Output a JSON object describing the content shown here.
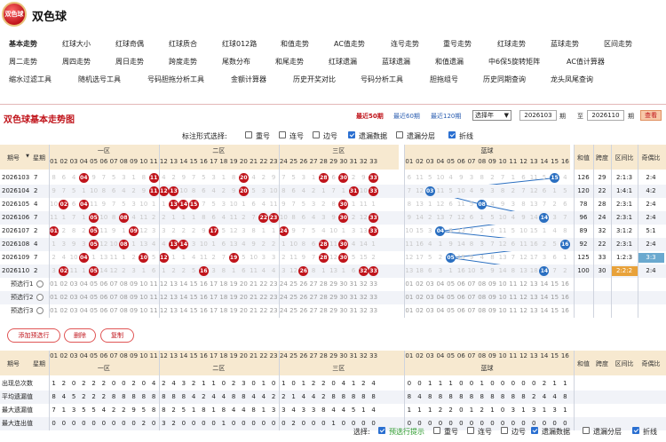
{
  "header": {
    "logo_text": "双色球",
    "title": "双色球"
  },
  "nav": {
    "rows": [
      [
        {
          "label": "基本走势",
          "bold": true
        },
        {
          "label": "红球大小"
        },
        {
          "label": "红球奇偶"
        },
        {
          "label": "红球质合"
        },
        {
          "label": "红球012路"
        },
        {
          "label": "和值走势"
        },
        {
          "label": "AC值走势"
        },
        {
          "label": "连号走势"
        },
        {
          "label": "重号走势"
        },
        {
          "label": "红球走势"
        },
        {
          "label": "蓝球走势"
        },
        {
          "label": "区间走势"
        }
      ],
      [
        {
          "label": "周二走势"
        },
        {
          "label": "周四走势"
        },
        {
          "label": "周日走势"
        },
        {
          "label": "跨度走势"
        },
        {
          "label": "尾数分布"
        },
        {
          "label": "和尾走势"
        },
        {
          "label": "红球遗漏"
        },
        {
          "label": "蓝球遗漏"
        },
        {
          "label": "和值遗漏"
        },
        {
          "label": "中6保5旋转矩阵"
        },
        {
          "label": "AC值计算器"
        }
      ],
      [
        {
          "label": "缩水过滤工具"
        },
        {
          "label": "随机选号工具"
        },
        {
          "label": "号码胆拖分析工具"
        },
        {
          "label": "金额计算器"
        },
        {
          "label": "历史开奖对比"
        },
        {
          "label": "号码分析工具"
        },
        {
          "label": "胆拖组号"
        },
        {
          "label": "历史同期查询"
        },
        {
          "label": "龙头凤尾查询"
        }
      ]
    ]
  },
  "panel": {
    "title": "双色球基本走势图",
    "links": [
      "最近50期",
      "最近60期",
      "最近120期"
    ],
    "select": "选择年",
    "from": "2026103",
    "from_unit": "期",
    "to_label": "至",
    "to": "2026110",
    "to_unit": "期",
    "query": "查看"
  },
  "options": {
    "label": "标注形式选择:",
    "items": [
      {
        "label": "重号",
        "on": false
      },
      {
        "label": "连号",
        "on": false
      },
      {
        "label": "边号",
        "on": false
      },
      {
        "label": "遗漏数据",
        "on": true
      },
      {
        "label": "遗漏分层",
        "on": false
      },
      {
        "label": "折线",
        "on": true
      }
    ]
  },
  "grid": {
    "col_headers": {
      "period": "期号",
      "sort": "▼",
      "weekday": "星期",
      "zone1": "一区",
      "zone2": "二区",
      "zone3": "三区",
      "blue": "蓝球",
      "sum": "和值",
      "span": "跨度",
      "ratio": "区间比",
      "odd": "奇偶比"
    },
    "draws": [
      {
        "period": "2026103",
        "weekday": "7",
        "red": [
          "04",
          "11",
          "20",
          "28",
          "30",
          "33"
        ],
        "blue": "15",
        "sum": "126",
        "span": "29",
        "ratio": "2:1:3",
        "odd": "2:4",
        "hl_ratio": false,
        "hl_odd": false
      },
      {
        "period": "2026104",
        "weekday": "2",
        "red": [
          "11",
          "12",
          "13",
          "20",
          "31",
          "33"
        ],
        "blue": "03",
        "sum": "120",
        "span": "22",
        "ratio": "1:4:1",
        "odd": "4:2",
        "hl_ratio": false,
        "hl_odd": false
      },
      {
        "period": "2026105",
        "weekday": "4",
        "red": [
          "02",
          "04",
          "13",
          "14",
          "15",
          "30"
        ],
        "blue": "08",
        "sum": "78",
        "span": "28",
        "ratio": "2:3:1",
        "odd": "2:4",
        "hl_ratio": false,
        "hl_odd": false
      },
      {
        "period": "2026106",
        "weekday": "7",
        "red": [
          "05",
          "08",
          "22",
          "23",
          "30",
          "33"
        ],
        "blue": "14",
        "sum": "96",
        "span": "24",
        "ratio": "2:3:1",
        "odd": "2:4",
        "hl_ratio": false,
        "hl_odd": false
      },
      {
        "period": "2026107",
        "weekday": "2",
        "red": [
          "01",
          "05",
          "09",
          "17",
          "24",
          "33"
        ],
        "blue": "04",
        "sum": "89",
        "span": "32",
        "ratio": "3:1:2",
        "odd": "5:1",
        "hl_ratio": false,
        "hl_odd": false
      },
      {
        "period": "2026108",
        "weekday": "4",
        "red": [
          "05",
          "08",
          "13",
          "14",
          "28",
          "30"
        ],
        "blue": "16",
        "sum": "92",
        "span": "22",
        "ratio": "2:3:1",
        "odd": "2:4",
        "hl_ratio": false,
        "hl_odd": false
      },
      {
        "period": "2026109",
        "weekday": "7",
        "red": [
          "04",
          "10",
          "12",
          "19",
          "28",
          "30"
        ],
        "blue": "05",
        "sum": "125",
        "span": "33",
        "ratio": "1:2:3",
        "odd": "3:3",
        "hl_ratio": false,
        "hl_odd": true
      },
      {
        "period": "2026110",
        "weekday": "2",
        "red": [
          "02",
          "05",
          "16",
          "26",
          "32",
          "33"
        ],
        "blue": "14",
        "sum": "100",
        "span": "30",
        "ratio": "2:2:2",
        "odd": "2:4",
        "hl_ratio": true,
        "hl_odd": false
      }
    ],
    "preds": [
      "预选行1",
      "预选行2",
      "预选行3"
    ]
  },
  "buttons": {
    "add": "添加预选行",
    "del": "删除",
    "copy": "复制"
  },
  "stats": {
    "rows": [
      {
        "label": "出现总次数",
        "red": [
          1,
          2,
          0,
          2,
          2,
          2,
          0,
          0,
          2,
          0,
          4,
          2,
          4,
          3,
          2,
          1,
          1,
          0,
          2,
          3,
          0,
          1,
          0,
          1,
          0,
          1,
          2,
          2,
          0,
          4,
          1,
          2,
          4
        ],
        "blue": [
          0,
          0,
          1,
          1,
          1,
          0,
          0,
          1,
          0,
          0,
          0,
          0,
          0,
          2,
          1,
          1
        ]
      },
      {
        "label": "平均遗漏值",
        "red": [
          8,
          4,
          5,
          2,
          2,
          2,
          8,
          8,
          8,
          8,
          8,
          8,
          8,
          8,
          4,
          2,
          4,
          4,
          8,
          8,
          4,
          4,
          2,
          2,
          1,
          4,
          4,
          2,
          8,
          8,
          8,
          8,
          8
        ],
        "blue": [
          8,
          4,
          8,
          8,
          8,
          8,
          8,
          8,
          8,
          8,
          8,
          8,
          2,
          4,
          4,
          8,
          4,
          2,
          6,
          8,
          3,
          8,
          8,
          4,
          2,
          3,
          2,
          2,
          8
        ]
      },
      {
        "label": "最大遗漏值",
        "red": [
          7,
          1,
          3,
          5,
          5,
          4,
          2,
          2,
          9,
          5,
          8,
          8,
          2,
          5,
          1,
          8,
          1,
          8,
          4,
          4,
          8,
          1,
          3,
          3,
          4,
          3,
          3,
          8,
          4,
          4,
          5,
          1,
          4
        ],
        "blue": [
          1,
          1,
          1,
          2,
          2,
          0,
          1,
          2,
          1,
          0,
          3,
          1,
          3,
          1,
          3,
          1
        ]
      },
      {
        "label": "最大连出值",
        "red": [
          0,
          0,
          0,
          0,
          0,
          0,
          0,
          0,
          0,
          2,
          0,
          3,
          2,
          0,
          0,
          0,
          0,
          1,
          0,
          0,
          0,
          0,
          0,
          0,
          2,
          0,
          0,
          0,
          1,
          0,
          0,
          0,
          0
        ],
        "blue": [
          0,
          0,
          0,
          0,
          0,
          0,
          0,
          0,
          0,
          0,
          0,
          0,
          0,
          0,
          0,
          0
        ]
      }
    ]
  },
  "bottom": {
    "label": "选择:",
    "items": [
      {
        "label": "预选行提示",
        "on": true,
        "green": true
      },
      {
        "label": "重号",
        "on": false
      },
      {
        "label": "连号",
        "on": false
      },
      {
        "label": "边号",
        "on": false
      },
      {
        "label": "遗漏数据",
        "on": true
      },
      {
        "label": "遗漏分层",
        "on": false
      },
      {
        "label": "折线",
        "on": true
      }
    ]
  },
  "colors": {
    "red": "#c0141b",
    "blue": "#2a6fc1",
    "zone": "#f7e9d0",
    "hl": "#e8a23a",
    "hl2": "#6aa9cf"
  }
}
